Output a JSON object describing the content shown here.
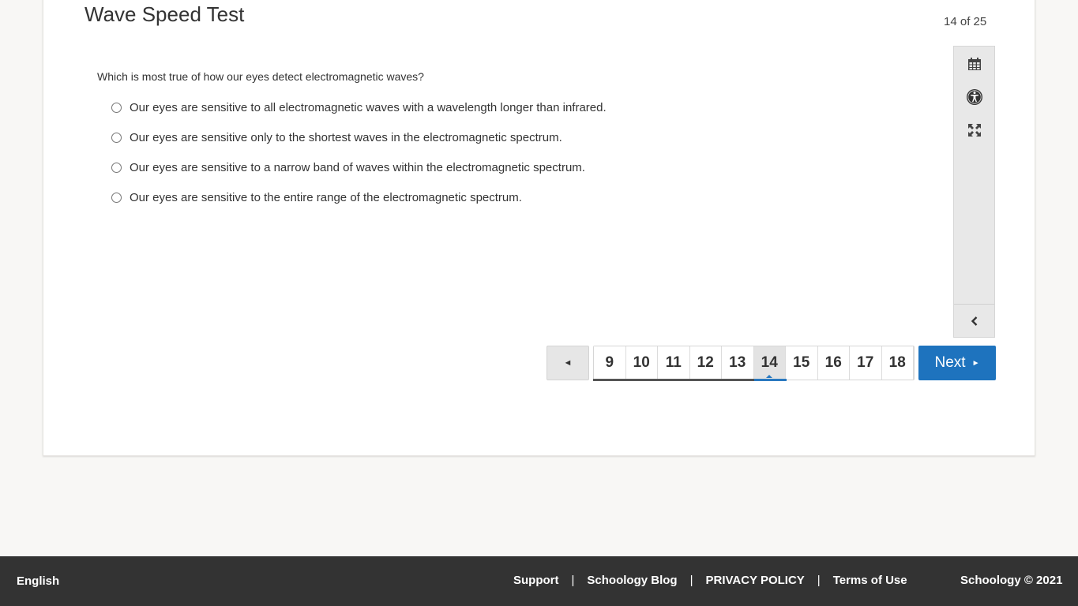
{
  "test": {
    "title": "Wave Speed Test",
    "counter": "14 of 25"
  },
  "question": {
    "prompt": "Which is most true of how our eyes detect electromagnetic waves?",
    "options": [
      "Our eyes are sensitive to all electromagnetic waves with a wavelength longer than infrared.",
      "Our eyes are sensitive only to the shortest waves in the electromagnetic spectrum.",
      "Our eyes are sensitive to a narrow band of waves within the electromagnetic spectrum.",
      "Our eyes are sensitive to the entire range of the electromagnetic spectrum."
    ]
  },
  "toolbar": {
    "tools": [
      "calendar-icon",
      "accessibility-icon",
      "fullscreen-icon"
    ],
    "collapse": "chevron-left-icon"
  },
  "pager": {
    "prev_label": "◄",
    "pages": [
      "9",
      "10",
      "11",
      "12",
      "13",
      "14",
      "15",
      "16",
      "17",
      "18"
    ],
    "current": "14",
    "next_label": "Next",
    "next_arrow": "►",
    "accent": "#1e73be"
  },
  "footer": {
    "language": "English",
    "links": [
      "Support",
      "Schoology Blog",
      "PRIVACY POLICY",
      "Terms of Use"
    ],
    "separator": "|",
    "copyright": "Schoology © 2021"
  }
}
